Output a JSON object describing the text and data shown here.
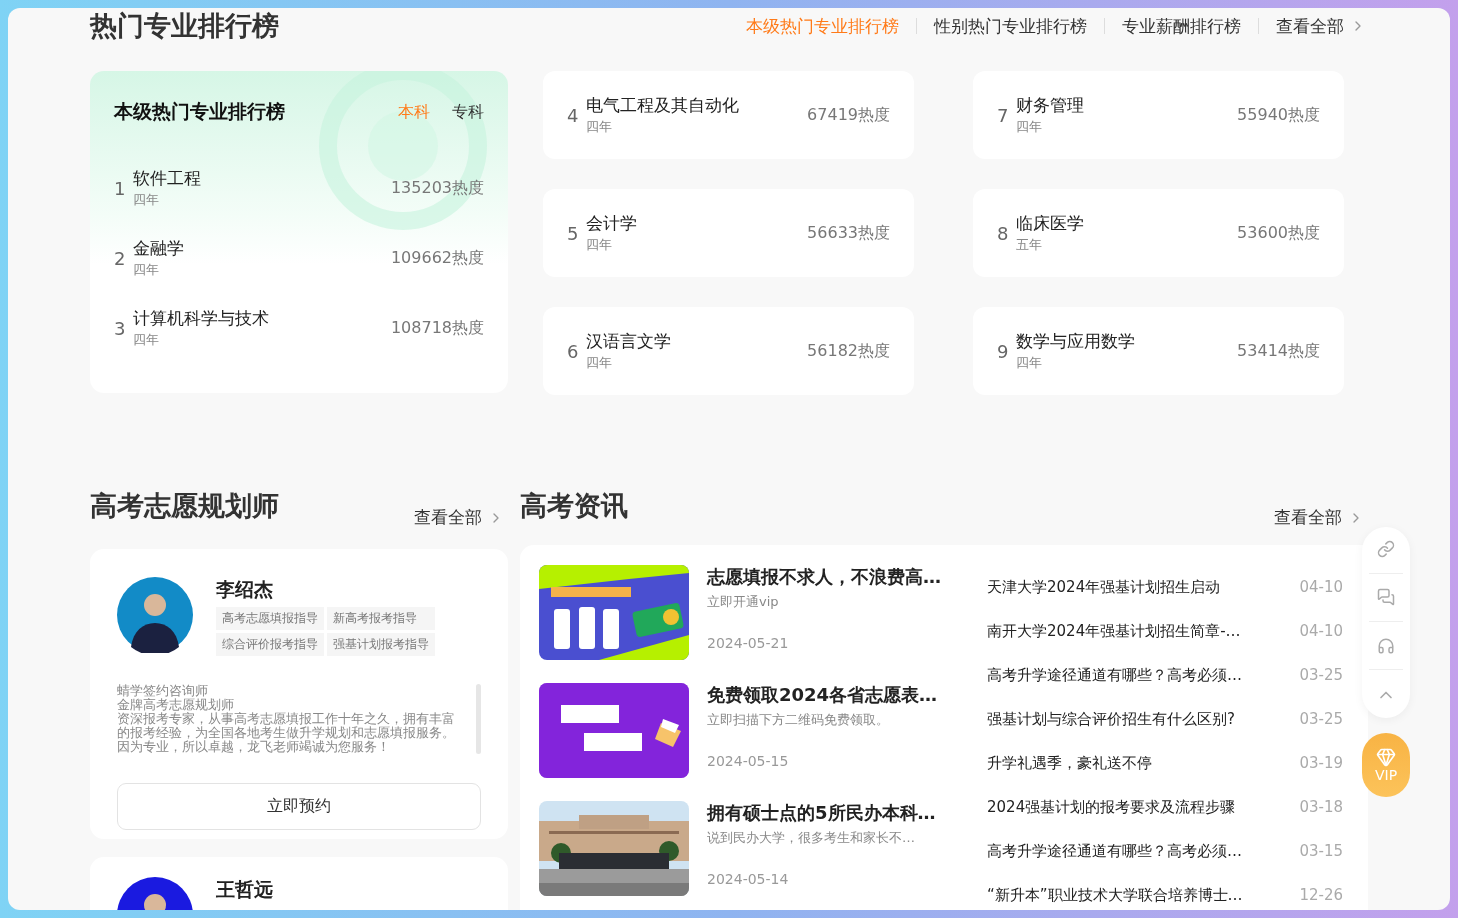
{
  "rankings": {
    "title": "热门专业排行榜",
    "tabs": [
      {
        "label": "本级热门专业排行榜",
        "selected": true
      },
      {
        "label": "性别热门专业排行榜",
        "selected": false
      },
      {
        "label": "专业薪酬排行榜",
        "selected": false
      }
    ],
    "view_all": "查看全部",
    "featured": {
      "title": "本级热门专业排行榜",
      "levels": [
        {
          "label": "本科",
          "selected": true
        },
        {
          "label": "专科",
          "selected": false
        }
      ],
      "items": [
        {
          "rank": "1",
          "name": "软件工程",
          "years": "四年",
          "heat": "135203热度"
        },
        {
          "rank": "2",
          "name": "金融学",
          "years": "四年",
          "heat": "109662热度"
        },
        {
          "rank": "3",
          "name": "计算机科学与技术",
          "years": "四年",
          "heat": "108718热度"
        }
      ]
    },
    "items": [
      {
        "rank": "4",
        "name": "电气工程及其自动化",
        "years": "四年",
        "heat": "67419热度"
      },
      {
        "rank": "5",
        "name": "会计学",
        "years": "四年",
        "heat": "56633热度"
      },
      {
        "rank": "6",
        "name": "汉语言文学",
        "years": "四年",
        "heat": "56182热度"
      },
      {
        "rank": "7",
        "name": "财务管理",
        "years": "四年",
        "heat": "55940热度"
      },
      {
        "rank": "8",
        "name": "临床医学",
        "years": "五年",
        "heat": "53600热度"
      },
      {
        "rank": "9",
        "name": "数学与应用数学",
        "years": "四年",
        "heat": "53414热度"
      }
    ]
  },
  "planners": {
    "title": "高考志愿规划师",
    "view_all": "查看全部",
    "items": [
      {
        "name": "李绍杰",
        "tags": [
          "高考志愿填报指导",
          "新高考报考指导",
          "综合评价报考指导",
          "强基计划报考指导"
        ],
        "bio": [
          "蜻学签约咨询师",
          "金牌高考志愿规划师",
          "资深报考专家，从事高考志愿填报工作十年之久，拥有丰富的报考经验，为全国各地考生做升学规划和志愿填报服务。因为专业，所以卓越，龙飞老师竭诚为您服务！"
        ],
        "button": "立即预约"
      },
      {
        "name": "王哲远"
      }
    ]
  },
  "news": {
    "title": "高考资讯",
    "view_all": "查看全部",
    "articles": [
      {
        "title": "志愿填报不求人，不浪费高…",
        "summary": "立即开通vip",
        "date": "2024-05-21",
        "kind": "picture"
      },
      {
        "title": "免费领取2024各省志愿表…",
        "summary": "立即扫描下方二维码免费领取。",
        "date": "2024-05-15",
        "kind": "picture"
      },
      {
        "title": "拥有硕士点的5所民办本科…",
        "summary": "说到民办大学，很多考生和家长不…",
        "date": "2024-05-14",
        "kind": "picture"
      }
    ],
    "headlines": [
      {
        "title": "天津大学2024年强基计划招生启动",
        "date": "04-10"
      },
      {
        "title": "南开大学2024年强基计划招生简章-…",
        "date": "04-10"
      },
      {
        "title": "高考升学途径通道有哪些？高考必须…",
        "date": "03-25"
      },
      {
        "title": "强基计划与综合评价招生有什么区别?",
        "date": "03-25"
      },
      {
        "title": "升学礼遇季，豪礼送不停",
        "date": "03-19"
      },
      {
        "title": "2024强基计划的报考要求及流程步骤",
        "date": "03-18"
      },
      {
        "title": "高考升学途径通道有哪些？高考必须…",
        "date": "03-15"
      },
      {
        "title": "“新升本”职业技术大学联合培养博士…",
        "date": "12-26"
      }
    ]
  },
  "float_bar": {
    "vip_label": "VIP"
  }
}
